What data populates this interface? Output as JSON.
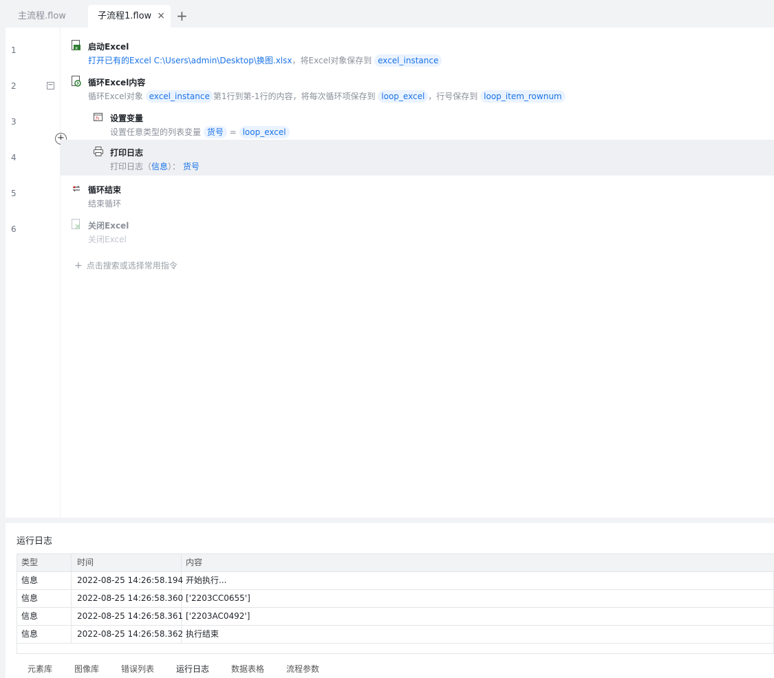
{
  "tabs": {
    "inactive": "主流程.flow",
    "active": "子流程1.flow",
    "close": "×",
    "add": "+"
  },
  "editor": {
    "line_numbers": [
      "1",
      "2",
      "3",
      "4",
      "5",
      "6"
    ],
    "steps": [
      {
        "icon": "excel-open-icon",
        "title": "启动Excel",
        "desc_prefix": "打开已有的Excel C:\\Users\\admin\\Desktop\\换图.xlsx",
        "desc_mid": "，将Excel对象保存到",
        "chip": "excel_instance"
      },
      {
        "icon": "excel-loop-icon",
        "title": "循环Excel内容",
        "desc_1": "循环Excel对象",
        "chip_1": "excel_instance",
        "desc_2": "第1行到第-1行的内容，将每次循环项保存到",
        "chip_2": "loop_excel",
        "desc_3": "，行号保存到",
        "chip_3": "loop_item_rownum"
      },
      {
        "icon": "set-variable-icon",
        "title": "设置变量",
        "desc_1": "设置任意类型的列表变量",
        "chip_1": "货号",
        "desc_2": "=",
        "chip_2": "loop_excel"
      },
      {
        "icon": "print-log-icon",
        "title": "打印日志",
        "desc_1": "打印日志（",
        "level": "信息",
        "desc_2": "）：",
        "value": "货号"
      },
      {
        "icon": "loop-end-icon",
        "title": "循环结束",
        "desc": "结束循环"
      },
      {
        "icon": "excel-close-icon",
        "title": "关闭Excel",
        "desc": "关闭Excel"
      }
    ],
    "add_command": "点击搜索或选择常用指令"
  },
  "log": {
    "title": "运行日志",
    "columns": [
      "类型",
      "时间",
      "内容"
    ],
    "rows": [
      {
        "type": "信息",
        "time": "2022-08-25 14:26:58.194",
        "content": "开始执行..."
      },
      {
        "type": "信息",
        "time": "2022-08-25 14:26:58.360",
        "content": "['2203CC0655']"
      },
      {
        "type": "信息",
        "time": "2022-08-25 14:26:58.361",
        "content": "['2203AC0492']"
      },
      {
        "type": "信息",
        "time": "2022-08-25 14:26:58.362",
        "content": "执行结束"
      }
    ]
  },
  "bottom_tabs": [
    "元素库",
    "图像库",
    "错误列表",
    "运行日志",
    "数据表格",
    "流程参数"
  ],
  "colors": {
    "accent": "#1a73e8",
    "chip_bg": "#eaf3ff",
    "highlight_row": "#eef0f3"
  }
}
